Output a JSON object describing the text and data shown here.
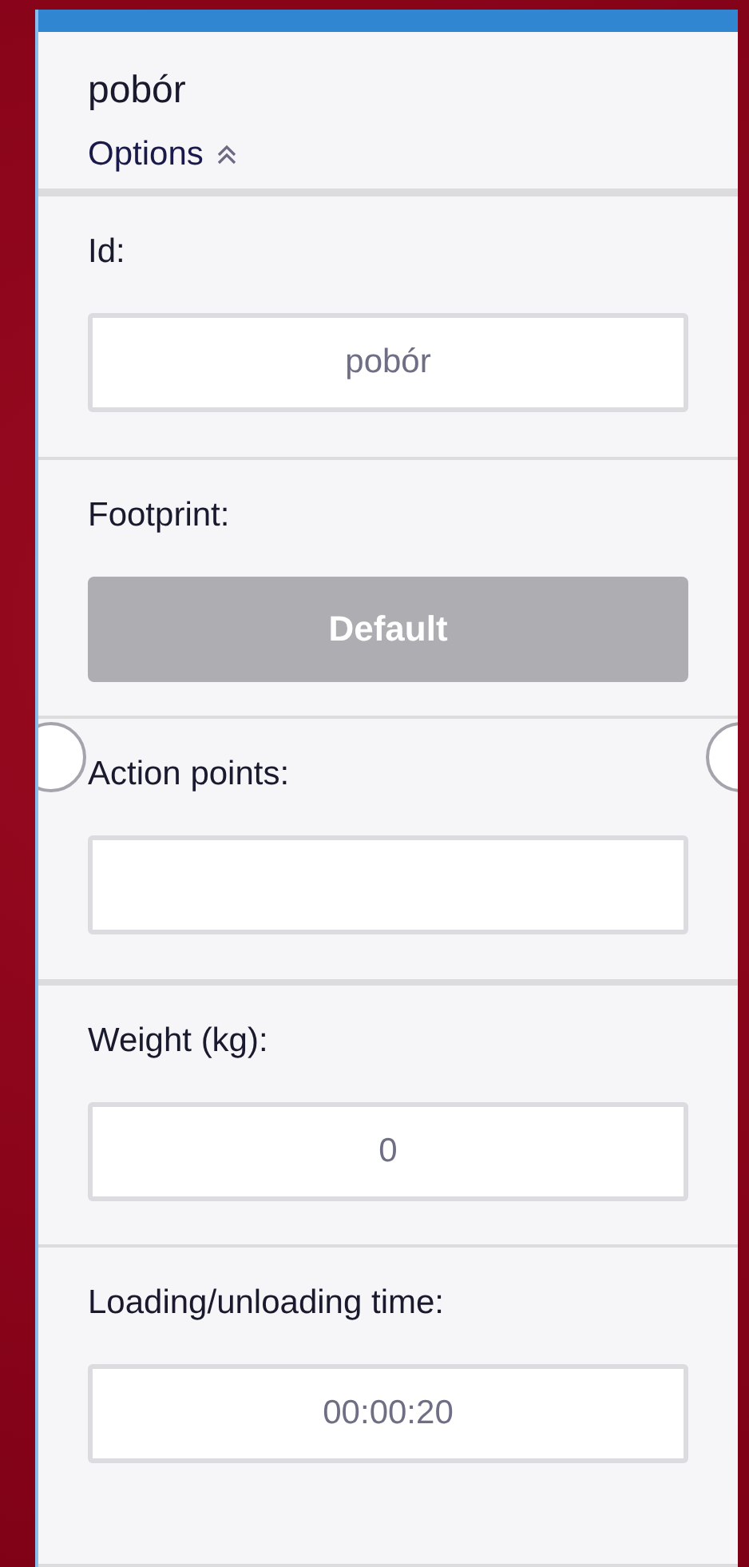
{
  "header": {
    "title": "pobór",
    "options": {
      "label": "Options",
      "expanded": true
    }
  },
  "fields": [
    {
      "kind": "input",
      "label": "Id:",
      "value": "pobór"
    },
    {
      "kind": "button",
      "label": "Footprint:",
      "value": "Default"
    },
    {
      "kind": "input",
      "label": "Action points:",
      "ports": true
    },
    {
      "kind": "input",
      "label": "Weight (kg):",
      "value": "0"
    },
    {
      "kind": "input",
      "label": "Loading/unloading time:",
      "value": "00:00:20"
    }
  ]
}
